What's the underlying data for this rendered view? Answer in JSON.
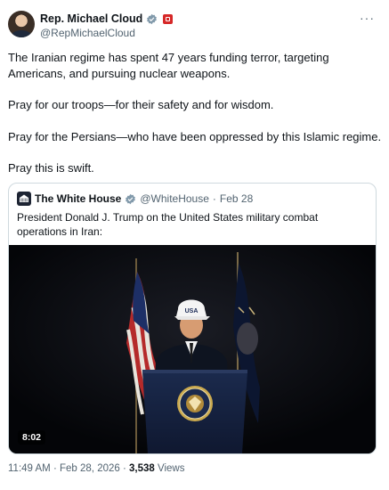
{
  "author": {
    "name": "Rep. Michael Cloud",
    "handle": "@RepMichaelCloud"
  },
  "more_label": "···",
  "post": {
    "paragraphs": [
      "The Iranian regime has spent 47 years funding terror, targeting Americans, and pursuing nuclear weapons.",
      "Pray for our troops—for their safety and for wisdom.",
      "Pray for the Persians—who have been oppressed by this Islamic regime.",
      "Pray this is swift."
    ]
  },
  "quote": {
    "name": "The White House",
    "handle": "@WhiteHouse",
    "separator": "·",
    "date": "Feb 28",
    "text": "President Donald J. Trump on the United States military combat operations in Iran:",
    "video": {
      "duration": "8:02",
      "hat_text": "USA"
    }
  },
  "meta": {
    "time": "11:49 AM",
    "separator": "·",
    "date": "Feb 28, 2026",
    "separator2": "·",
    "views_count": "3,538",
    "views_label": "Views"
  },
  "colors": {
    "verified": "#829aab",
    "badge": "#d62828",
    "border": "#cfd9de",
    "muted": "#536471"
  }
}
